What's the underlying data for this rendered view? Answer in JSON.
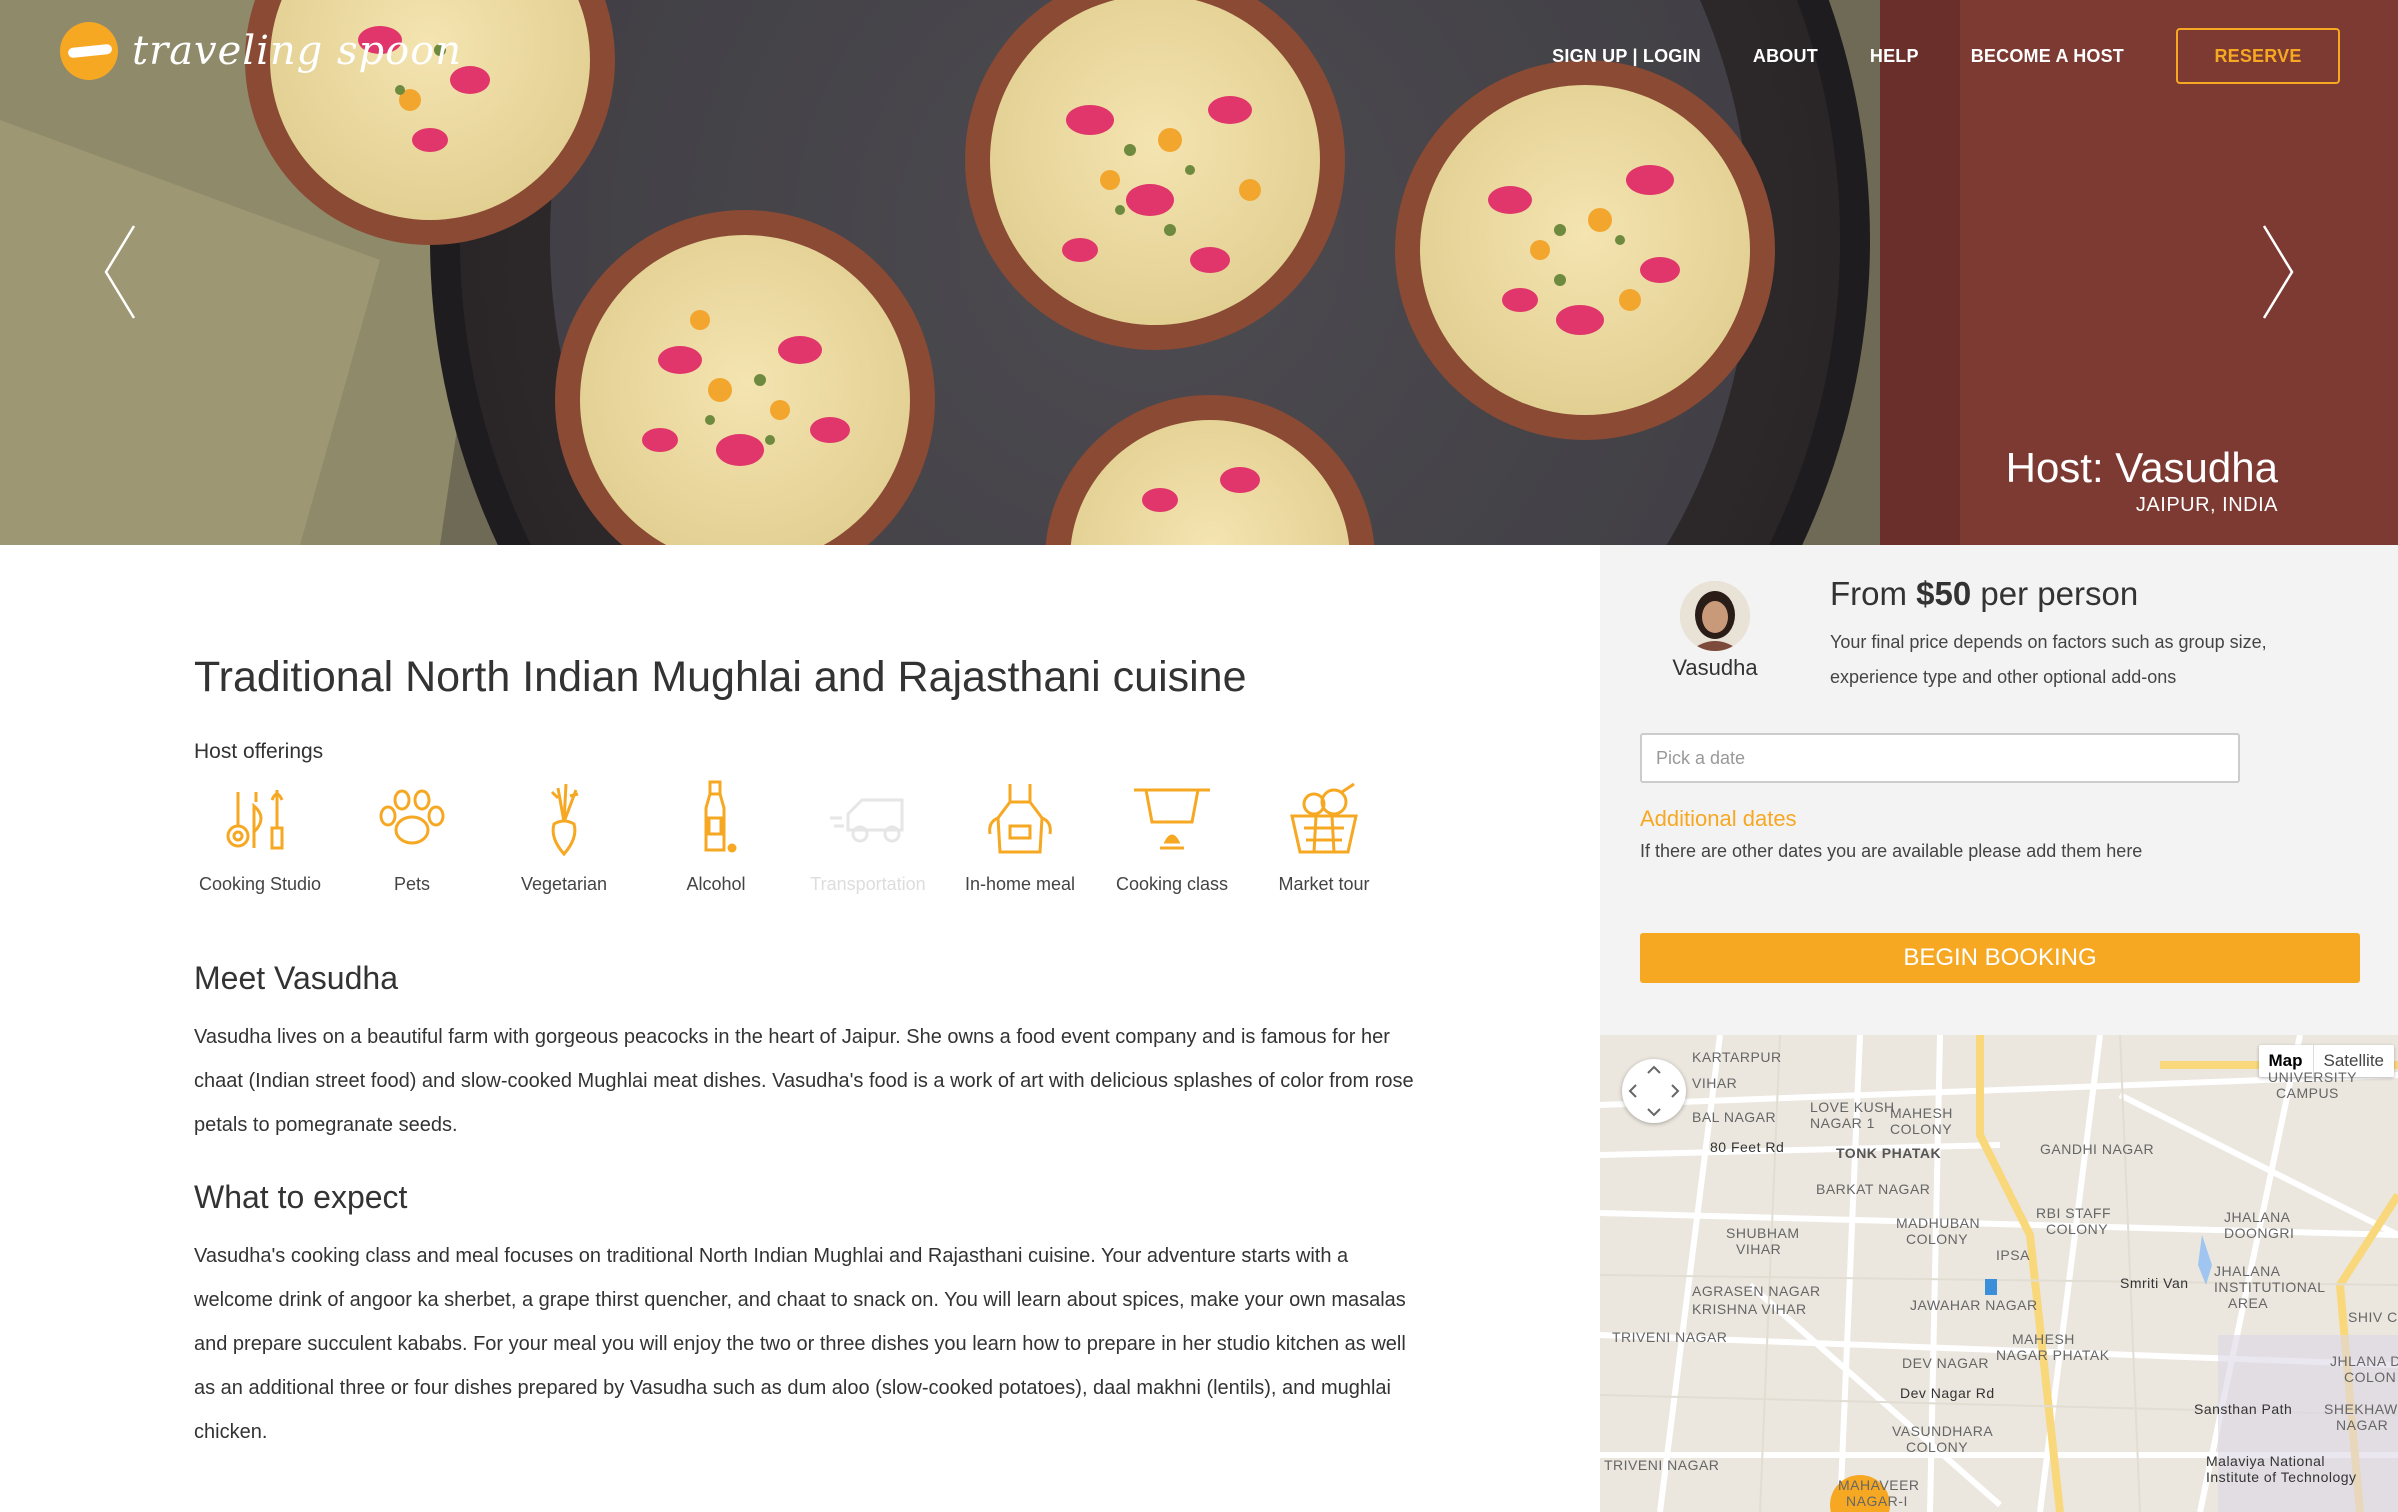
{
  "brand": {
    "logo_text": "traveling spoon",
    "accent_color": "#f7a823"
  },
  "nav": {
    "signup": "SIGN UP | LOGIN",
    "about": "ABOUT",
    "help": "HELP",
    "become_host": "BECOME A HOST",
    "reserve": "RESERVE"
  },
  "hero": {
    "host_name": "Host: Vasudha",
    "location": "JAIPUR, INDIA",
    "prev_icon": "chevron-left-icon",
    "next_icon": "chevron-right-icon"
  },
  "main": {
    "title": "Traditional North Indian Mughlai and Rajasthani cuisine",
    "offerings_label": "Host offerings",
    "offerings": [
      {
        "label": "Cooking Studio",
        "icon": "utensils-icon",
        "enabled": true
      },
      {
        "label": "Pets",
        "icon": "paw-icon",
        "enabled": true
      },
      {
        "label": "Vegetarian",
        "icon": "radish-icon",
        "enabled": true
      },
      {
        "label": "Alcohol",
        "icon": "bottle-icon",
        "enabled": true
      },
      {
        "label": "Transportation",
        "icon": "car-icon",
        "enabled": false
      },
      {
        "label": "In-home meal",
        "icon": "apron-icon",
        "enabled": true
      },
      {
        "label": "Cooking class",
        "icon": "pot-icon",
        "enabled": true
      },
      {
        "label": "Market tour",
        "icon": "basket-icon",
        "enabled": true
      }
    ],
    "meet_heading": "Meet Vasudha",
    "meet_text": "Vasudha lives on a beautiful farm with gorgeous peacocks in the heart of Jaipur. She owns a food event company and is famous for her chaat (Indian street food) and slow-cooked Mughlai meat dishes. Vasudha's food is a work of art with delicious splashes of color from rose petals to pomegranate seeds.",
    "expect_heading": "What to expect",
    "expect_text": "Vasudha's cooking class and meal focuses on traditional North Indian Mughlai and Rajasthani cuisine. Your adventure starts with a welcome drink of angoor ka sherbet, a grape thirst quencher, and chaat to snack on. You will learn about spices, make your own masalas and prepare succulent kababs. For your meal you will enjoy the two or three dishes you learn how to prepare in her studio kitchen as well as an additional three or four dishes prepared by Vasudha such as dum aloo (slow-cooked potatoes), daal makhni (lentils), and mughlai chicken."
  },
  "booking": {
    "host_first_name": "Vasudha",
    "price_prefix": "From ",
    "price_amount": "$50",
    "price_suffix": " per person",
    "price_note": "Your final price depends on factors such as group size, experience type and other optional add-ons",
    "date_placeholder": "Pick a date",
    "additional_dates_label": "Additional dates",
    "additional_dates_note": "If there are other dates you are available please add them here",
    "begin_button": "BEGIN BOOKING"
  },
  "map": {
    "type_map": "Map",
    "type_satellite": "Satellite",
    "labels": {
      "kartarpur": "KARTARPUR",
      "vihar": "VIHAR",
      "bal_nagar": "BAL NAGAR",
      "love_kush": "LOVE KUSH",
      "nagar_1": "NAGAR 1",
      "mahesh_colony": "MAHESH",
      "colony": "COLONY",
      "university_campus": "UNIVERSITY",
      "campus": "CAMPUS",
      "eighty_feet": "80 Feet Rd",
      "tonk_phatak": "TONK PHATAK",
      "gandhi_nagar": "GANDHI NAGAR",
      "barkat_nagar": "BARKAT NAGAR",
      "madhuban": "MADHUBAN",
      "madhuban_colony": "COLONY",
      "rbi_staff": "RBI STAFF",
      "rbi_colony": "COLONY",
      "jhalana": "JHALANA",
      "doongri": "DOONGRI",
      "shubham": "SHUBHAM",
      "shubham_vihar": "VIHAR",
      "ipsa": "IPSA",
      "agrasen": "AGRASEN NAGAR",
      "krishna": "KRISHNA VIHAR",
      "jawahar": "JAWAHAR NAGAR",
      "smriti_van": "Smriti Van",
      "jhalana_inst": "JHALANA",
      "institutional": "INSTITUTIONAL",
      "area": "AREA",
      "triveni": "TRIVENI NAGAR",
      "mahesh_phatak": "MAHESH",
      "nagar_phatak": "NAGAR PHATAK",
      "dev_nagar": "DEV NAGAR",
      "dev_nagar_rd": "Dev Nagar Rd",
      "vasundhara": "VASUNDHARA",
      "vasundhara_colony": "COLONY",
      "sansthan": "Sansthan Path",
      "malaviya": "Malaviya National",
      "institute": "Institute of Technology",
      "triveni2": "TRIVENI NAGAR",
      "mahaveer": "MAHAVEER",
      "mahaveer_nagar": "NAGAR-I",
      "jhalana_colony": "JHLANA D",
      "jhalana_colony2": "COLON",
      "shekhawati": "SHEKHAW",
      "shekhawati2": "NAGAR",
      "shiv": "SHIV C"
    }
  }
}
